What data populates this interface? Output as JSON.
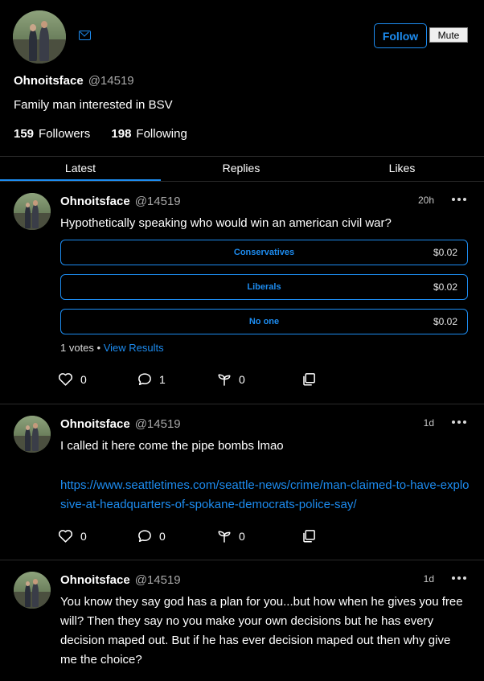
{
  "profile": {
    "name": "Ohnoitsface",
    "handle": "@14519",
    "bio": "Family man interested in BSV",
    "followers_count": "159",
    "followers_label": "Followers",
    "following_count": "198",
    "following_label": "Following",
    "follow_label": "Follow",
    "mute_label": "Mute"
  },
  "tabs": [
    {
      "label": "Latest",
      "active": true
    },
    {
      "label": "Replies",
      "active": false
    },
    {
      "label": "Likes",
      "active": false
    }
  ],
  "posts": [
    {
      "name": "Ohnoitsface",
      "handle": "@14519",
      "time": "20h",
      "text": "Hypothetically speaking who would win an american civil war?",
      "poll": {
        "options": [
          {
            "label": "Conservatives",
            "price": "$0.02"
          },
          {
            "label": "Liberals",
            "price": "$0.02"
          },
          {
            "label": "No one",
            "price": "$0.02"
          }
        ],
        "votes": "1 votes",
        "separator": "•",
        "view_results": "View Results"
      },
      "likes": "0",
      "replies": "1",
      "tips": "0"
    },
    {
      "name": "Ohnoitsface",
      "handle": "@14519",
      "time": "1d",
      "text": "I called it here come the pipe bombs lmao",
      "link": "https://www.seattletimes.com/seattle-news/crime/man-claimed-to-have-explosive-at-headquarters-of-spokane-democrats-police-say/",
      "likes": "0",
      "replies": "0",
      "tips": "0"
    },
    {
      "name": "Ohnoitsface",
      "handle": "@14519",
      "time": "1d",
      "text": "You know they say god has a plan for you...but how when he gives you free will? Then they say no you make your own decisions but he has every decision maped out. But if he has ever decision maped out then why give me the choice?"
    }
  ],
  "colors": {
    "accent": "#1d8cf0",
    "background": "#000000",
    "muted_text": "#a8a8a8"
  }
}
